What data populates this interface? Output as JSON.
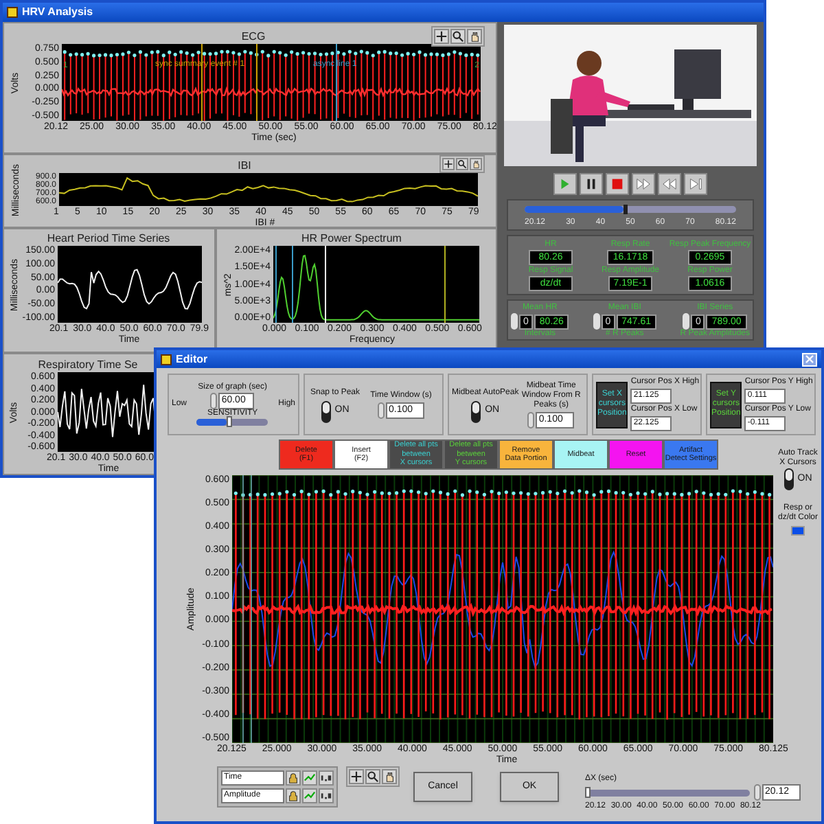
{
  "hrv_window": {
    "title": "HRV Analysis",
    "ecg": {
      "title": "ECG",
      "ylabel": "Volts",
      "yticks": [
        "0.750",
        "0.500",
        "0.250",
        "0.000",
        "-0.250",
        "-0.500"
      ],
      "xticks": [
        "20.12",
        "25.00",
        "30.00",
        "35.00",
        "40.00",
        "45.00",
        "50.00",
        "55.00",
        "60.00",
        "65.00",
        "70.00",
        "75.00",
        "80.12"
      ],
      "xlabel": "Time (sec)",
      "annotations": [
        {
          "text": "sync summary event # 1",
          "color": "#c8a000"
        },
        {
          "text": "async line 1",
          "color": "#3a9cc8"
        }
      ],
      "cursor_labels": [
        "1",
        "2"
      ]
    },
    "ibi": {
      "title": "IBI",
      "ylabel": "Milliseconds",
      "yticks": [
        "900.0",
        "800.0",
        "700.0",
        "600.0"
      ],
      "xticks": [
        "1",
        "5",
        "10",
        "15",
        "20",
        "25",
        "30",
        "35",
        "40",
        "45",
        "50",
        "55",
        "60",
        "65",
        "70",
        "75",
        "79"
      ],
      "xlabel": "IBI #"
    },
    "heart_period": {
      "title": "Heart Period Time Series",
      "ylabel": "Milliseconds",
      "yticks": [
        "150.00",
        "100.00",
        "50.00",
        "0.00",
        "-50.00",
        "-100.00"
      ],
      "xticks": [
        "20.1",
        "30.0",
        "40.0",
        "50.0",
        "60.0",
        "70.0",
        "79.9"
      ],
      "xlabel": "Time"
    },
    "power_spectrum": {
      "title": "HR Power Spectrum",
      "ylabel": "ms^2",
      "yticks": [
        "2.00E+4",
        "1.50E+4",
        "1.00E+4",
        "5.00E+3",
        "0.00E+0"
      ],
      "xticks": [
        "0.000",
        "0.100",
        "0.200",
        "0.300",
        "0.400",
        "0.500",
        "0.600"
      ],
      "xlabel": "Frequency"
    },
    "respiratory": {
      "title": "Respiratory Time Se",
      "ylabel": "Volts",
      "yticks": [
        "0.600",
        "0.400",
        "0.200",
        "0.000",
        "-0.200",
        "-0.400",
        "-0.600"
      ],
      "xticks": [
        "20.1",
        "30.0",
        "40.0",
        "50.0",
        "60.0"
      ],
      "xlabel": "Time"
    },
    "player": {
      "level": 0.47,
      "ticks": [
        "20.12",
        "30",
        "40",
        "50",
        "60",
        "70",
        "80.12"
      ]
    },
    "readouts": [
      {
        "label": "HR",
        "value": "80.26"
      },
      {
        "label": "Resp Rate",
        "value": "16.1718"
      },
      {
        "label": "Resp Peak Frequency",
        "value": "0.2695"
      },
      {
        "label": "Resp Signal",
        "value": "dz/dt"
      },
      {
        "label": "Resp Amplitude",
        "value": "7.19E-1"
      },
      {
        "label": "Resp Power",
        "value": "1.0616"
      }
    ],
    "counters": [
      {
        "label": "Mean HR",
        "index": "0",
        "value": "80.26",
        "sublabel": "Intervals"
      },
      {
        "label": "Mean IBI",
        "index": "0",
        "value": "747.61",
        "sublabel": "# R Peaks"
      },
      {
        "label": "IBI Series",
        "index": "0",
        "value": "789.00",
        "sublabel": "R Peak Amplitudes"
      }
    ]
  },
  "editor": {
    "title": "Editor",
    "graph_size": {
      "label": "Size of graph (sec)",
      "value": "60.00",
      "slider_label": "SENSITIVITY",
      "low": "Low",
      "high": "High",
      "level": 0.42
    },
    "peak_groups": [
      {
        "label": "Snap to Peak",
        "on": true,
        "state": "ON",
        "window_label": "Time Window (s)",
        "window_value": "0.100"
      },
      {
        "label": "Midbeat AutoPeak",
        "on": true,
        "state": "ON",
        "window_label": "Midbeat Time Window From R Peaks (s)",
        "window_value": "0.100"
      }
    ],
    "cursor_groups": [
      {
        "button": "Set X cursors Position",
        "kind": "x_cursors",
        "high_label": "Cursor Pos X High",
        "high": "21.125",
        "low_label": "Cursor Pos X Low",
        "low": "22.125"
      },
      {
        "button": "Set Y cursors Position",
        "kind": "y_cursors",
        "high_label": "Cursor Pos Y High",
        "high": "0.111",
        "low_label": "Cursor Pos Y Low",
        "low": "-0.111"
      }
    ],
    "actions": [
      {
        "lines": [
          "Delete",
          "(F1)"
        ],
        "color": "#ee2a1e",
        "kind": "plain"
      },
      {
        "lines": [
          "Insert",
          "(F2)"
        ],
        "color": "#ffffff",
        "kind": "plain"
      },
      {
        "lines": [
          "Delete all pts",
          "between",
          "X cursors"
        ],
        "color": "#4a4a4a",
        "kind": "x_cursors"
      },
      {
        "lines": [
          "Delete all pts",
          "between",
          "Y cursors"
        ],
        "color": "#4a4a4a",
        "kind": "y_cursors"
      },
      {
        "lines": [
          "Remove",
          "Data Portion"
        ],
        "color": "#f8b43c",
        "kind": "plain"
      },
      {
        "lines": [
          "Midbeat"
        ],
        "color": "#a8f4f4",
        "kind": "plain"
      },
      {
        "lines": [
          "Reset"
        ],
        "color": "#f414f0",
        "kind": "plain"
      },
      {
        "lines": [
          "Artifact",
          "Detect Settings"
        ],
        "color": "#3a78f0",
        "kind": "plain"
      }
    ],
    "auto_track": {
      "label": "Auto Track X Cursors",
      "on": true,
      "state": "ON"
    },
    "resp_color": {
      "label": "Resp or dz/dt Color",
      "color": "#0a4ee8"
    },
    "graph": {
      "ylabel": "Amplitude",
      "yticks": [
        "0.600",
        "0.500",
        "0.400",
        "0.300",
        "0.200",
        "0.100",
        "0.000",
        "-0.100",
        "-0.200",
        "-0.300",
        "-0.400",
        "-0.500"
      ],
      "xticks": [
        "20.125",
        "25.000",
        "30.000",
        "35.000",
        "40.000",
        "45.000",
        "50.000",
        "55.000",
        "60.000",
        "65.000",
        "70.000",
        "75.000",
        "80.125"
      ],
      "xlabel": "Time"
    },
    "legend": [
      {
        "name": "Time"
      },
      {
        "name": "Amplitude"
      }
    ],
    "buttons": [
      {
        "label": "Cancel"
      },
      {
        "label": "OK"
      }
    ],
    "window_slider": {
      "label": "ΔX (sec)",
      "value": "20.12",
      "level": 0,
      "ticks": [
        "20.12",
        "30.00",
        "40.00",
        "50.00",
        "60.00",
        "70.00",
        "80.12"
      ]
    }
  }
}
